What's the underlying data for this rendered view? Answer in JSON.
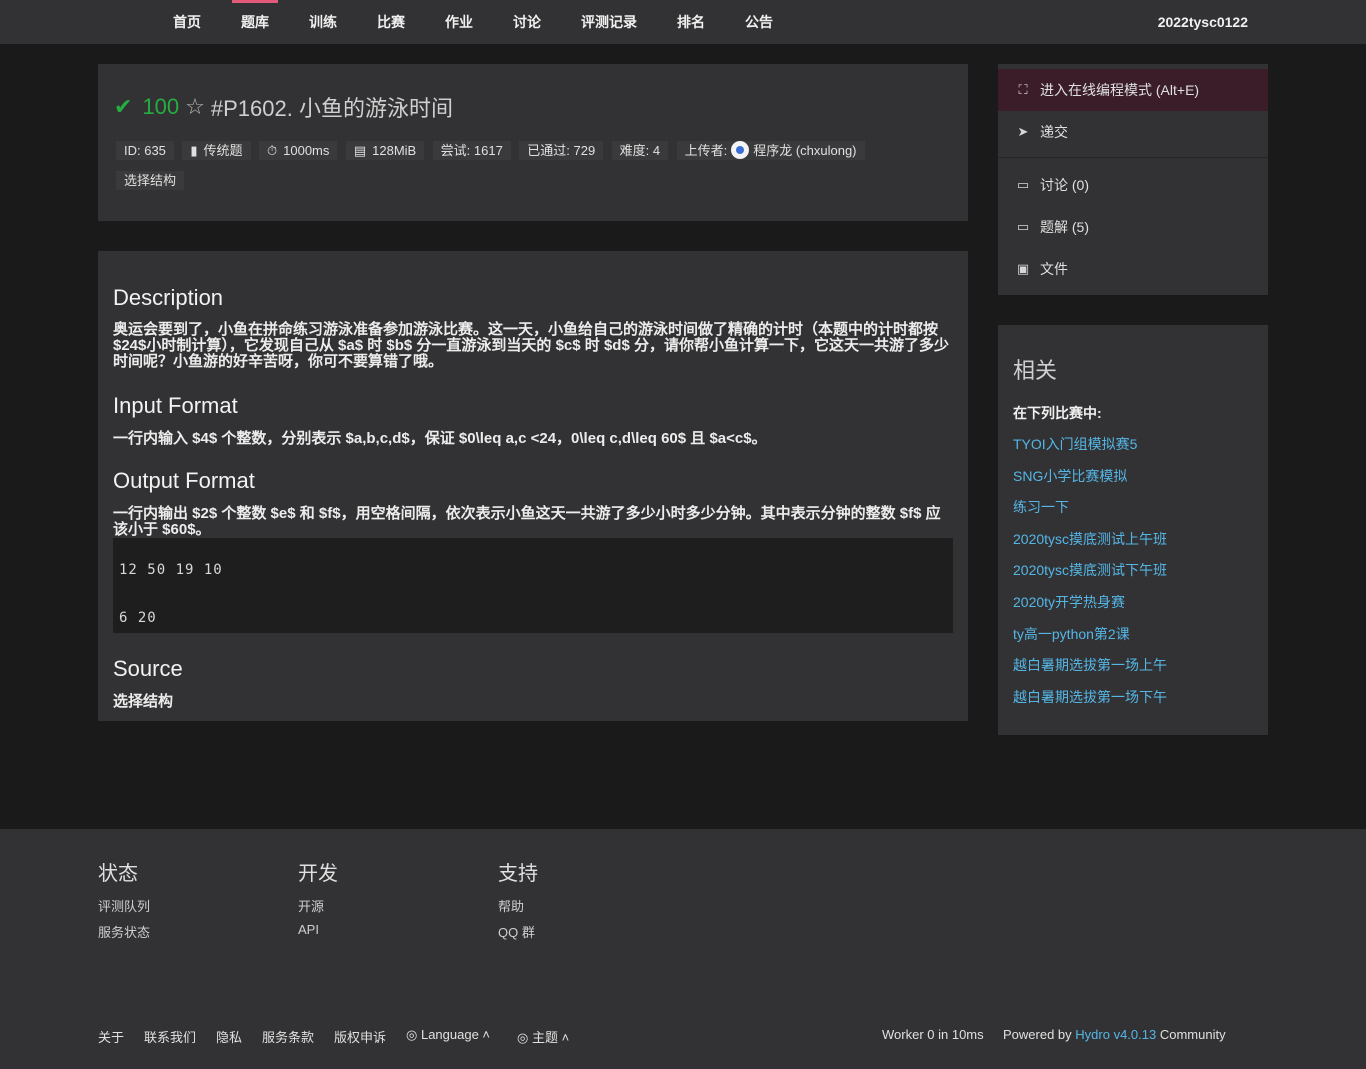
{
  "nav": {
    "items": [
      "首页",
      "题库",
      "训练",
      "比赛",
      "作业",
      "讨论",
      "评测记录",
      "排名",
      "公告"
    ],
    "active_index": 1,
    "user": "2022tysc0122"
  },
  "problem": {
    "score": "100",
    "title": "#P1602. 小鱼的游泳时间",
    "meta": {
      "id": "ID: 635",
      "type": "传统题",
      "time": "1000ms",
      "memory": "128MiB",
      "tried": "尝试: 1617",
      "accepted": "已通过: 729",
      "difficulty": "难度: 4",
      "uploader_label": "上传者:",
      "uploader": "程序龙 (chxulong)",
      "tag": "选择结构"
    }
  },
  "content": {
    "description_title": "Description",
    "description": "奥运会要到了，小鱼在拼命练习游泳准备参加游泳比赛。这一天，小鱼给自己的游泳时间做了精确的计时（本题中的计时都按$24$小时制计算），它发现自己从 $a$ 时 $b$ 分一直游泳到当天的 $c$ 时 $d$ 分，请你帮小鱼计算一下，它这天一共游了多少时间呢？小鱼游的好辛苦呀，你可不要算错了哦。",
    "input_title": "Input Format",
    "input": "一行内输入 $4$ 个整数，分别表示 $a,b,c,d$，保证 $0\\leq a,c <24，0\\leq c,d\\leq 60$ 且 $a<c$。",
    "output_title": "Output Format",
    "output": "一行内输出 $2$ 个整数 $e$ 和 $f$，用空格间隔，依次表示小鱼这天一共游了多少小时多少分钟。其中表示分钟的整数 $f$ 应该小于 $60$。",
    "sample_input": "12 50 19 10",
    "sample_output": "6 20",
    "source_title": "Source",
    "source": "选择结构"
  },
  "sidebar": {
    "code_mode": "进入在线编程模式 (Alt+E)",
    "submit": "递交",
    "discuss": "讨论 (0)",
    "solution": "题解 (5)",
    "files": "文件",
    "related_title": "相关",
    "related_sub": "在下列比赛中:",
    "related": [
      "TYOI入门组模拟赛5",
      "SNG小学比赛模拟",
      "练习一下",
      "2020tysc摸底测试上午班",
      "2020tysc摸底测试下午班",
      "2020ty开学热身赛",
      "ty高一python第2课",
      "越白暑期选拔第一场上午",
      "越白暑期选拔第一场下午"
    ]
  },
  "footer": {
    "status_title": "状态",
    "status_links": [
      "评测队列",
      "服务状态"
    ],
    "dev_title": "开发",
    "dev_links": [
      "开源",
      "API"
    ],
    "support_title": "支持",
    "support_links": [
      "帮助",
      "QQ 群"
    ],
    "bottom_links": [
      "关于",
      "联系我们",
      "隐私",
      "服务条款",
      "版权申诉"
    ],
    "language": "Language",
    "theme": "主题",
    "worker": "Worker 0 in 10ms",
    "powered_prefix": "Powered by",
    "hydro": "Hydro v4.0.13",
    "community": "Community"
  }
}
